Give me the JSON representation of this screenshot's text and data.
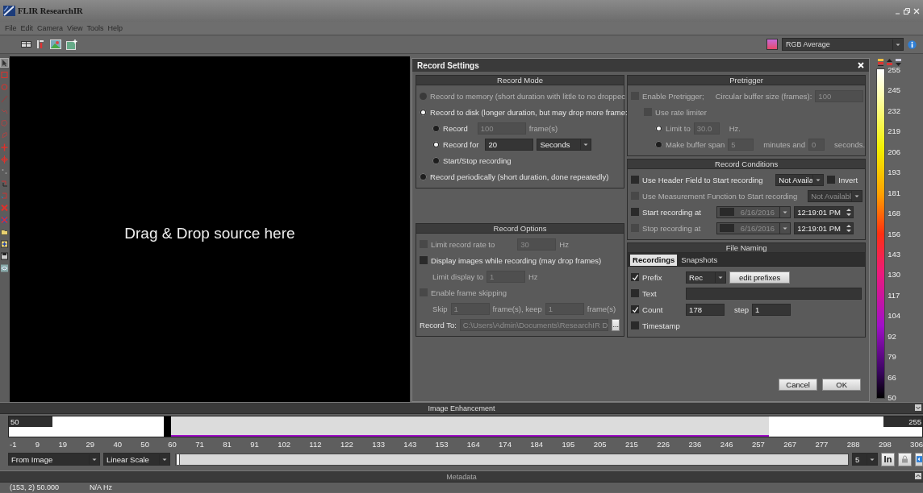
{
  "window": {
    "title": "FLIR ResearchIR"
  },
  "menu": [
    {
      "label": "File"
    },
    {
      "label": "Edit"
    },
    {
      "label": "Camera"
    },
    {
      "label": "View"
    },
    {
      "label": "Tools"
    },
    {
      "label": "Help"
    }
  ],
  "palette": {
    "value": "RGB Average"
  },
  "viewer": {
    "message": "Drag & Drop source here"
  },
  "record_settings": {
    "title": "Record Settings",
    "record_mode": {
      "title": "Record Mode",
      "options": [
        {
          "label": "Record to memory (short duration with little to no droppec",
          "selected": false,
          "disabled": true
        },
        {
          "label": "Record to disk (longer duration, but may drop more frame:",
          "selected": true,
          "disabled": false,
          "children": [
            {
              "label": "Record",
              "selected": false,
              "field": {
                "value": "100",
                "disabled": true
              },
              "unit": "frame(s)"
            },
            {
              "label": "Record for",
              "selected": true,
              "field": {
                "value": "20",
                "disabled": false
              },
              "dropdown": "Seconds"
            },
            {
              "label": "Start/Stop recording",
              "selected": false
            }
          ]
        },
        {
          "label": "Record periodically (short duration, done repeatedly)",
          "selected": false,
          "disabled": false
        }
      ]
    },
    "record_options": {
      "title": "Record Options",
      "rows": [
        {
          "label": "Limit record rate to",
          "checked": false,
          "disabled": true,
          "field": "30",
          "unit": "Hz"
        },
        {
          "label": "Display images while recording (may drop frames)",
          "checked": false,
          "disabled": false,
          "children": [
            {
              "label": "Limit display to",
              "field": "1",
              "unit": "Hz",
              "disabled": true
            }
          ]
        },
        {
          "label": "Enable frame skipping",
          "checked": false,
          "disabled": true,
          "children": [
            {
              "label": "Skip",
              "field": "1",
              "unit": "frame(s), keep",
              "field2": "1",
              "unit2": "frame(s)",
              "disabled": true
            }
          ]
        }
      ],
      "record_to": {
        "label": "Record To:",
        "value": "C:\\Users\\Admin\\Documents\\ResearchIR D",
        "browse": "..."
      }
    },
    "pretrigger": {
      "title": "Pretrigger",
      "enable": {
        "label": "Enable Pretrigger;",
        "checked": false,
        "disabled": true
      },
      "buffer_label": "Circular buffer size (frames):",
      "buffer_value": "100",
      "rate_limiter": {
        "label": "Use rate limiter",
        "checked": false,
        "disabled": true
      },
      "limit": {
        "label": "Limit to",
        "selected": true,
        "value": "30.0",
        "unit": "Hz."
      },
      "span": {
        "label": "Make buffer span",
        "selected": false,
        "minutes": "5",
        "minutes_label": "minutes and",
        "seconds": "0",
        "seconds_label": "seconds."
      }
    },
    "record_conditions": {
      "title": "Record Conditions",
      "rows": [
        {
          "kind": "select",
          "label": "Use Header Field to Start recording",
          "checked": false,
          "disabled": false,
          "select": "Not Availa",
          "invert": {
            "label": "Invert",
            "checked": false
          }
        },
        {
          "kind": "select",
          "label": "Use Measurement Function to Start recording",
          "checked": false,
          "disabled": true,
          "select": "Not Availabl"
        },
        {
          "kind": "time",
          "label": "Start recording at",
          "checked": false,
          "disabled": false,
          "date_checked": false,
          "date": "6/16/2016",
          "time": "12:19:01 PM"
        },
        {
          "kind": "time",
          "label": "Stop recording at",
          "checked": false,
          "disabled": true,
          "date_checked": false,
          "date": "6/16/2016",
          "time": "12:19:01 PM"
        }
      ]
    },
    "file_naming": {
      "title": "File Naming",
      "tabs": [
        {
          "label": "Recordings",
          "selected": true
        },
        {
          "label": "Snapshots",
          "selected": false
        }
      ],
      "prefix": {
        "label": "Prefix",
        "checked": true,
        "value": "Rec",
        "button": "edit prefixes"
      },
      "text": {
        "label": "Text",
        "checked": false
      },
      "count": {
        "label": "Count",
        "checked": true,
        "value": "178",
        "step_label": "step",
        "step": "1"
      },
      "timestamp": {
        "label": "Timestamp",
        "checked": false
      }
    },
    "buttons": [
      {
        "label": "Cancel"
      },
      {
        "label": "OK"
      }
    ]
  },
  "color_scale": {
    "labels": [
      "255",
      "245",
      "232",
      "219",
      "206",
      "193",
      "181",
      "168",
      "156",
      "143",
      "130",
      "117",
      "104",
      "92",
      "79",
      "66",
      "50"
    ]
  },
  "image_enhancement": {
    "title": "Image Enhancement",
    "min": "50",
    "max": "255",
    "ticks": [
      "-1",
      "9",
      "19",
      "29",
      "40",
      "50",
      "60",
      "71",
      "81",
      "91",
      "102",
      "112",
      "122",
      "133",
      "143",
      "153",
      "164",
      "174",
      "184",
      "195",
      "205",
      "215",
      "226",
      "236",
      "246",
      "257",
      "267",
      "277",
      "288",
      "298",
      "306"
    ],
    "source": "From Image",
    "scale": "Linear Scale",
    "slider": {
      "level": 0
    },
    "step": "5",
    "in_button": "In"
  },
  "metadata": {
    "title": "Metadata",
    "position": "(153, 2) 50.000",
    "rate": "N/A Hz"
  }
}
